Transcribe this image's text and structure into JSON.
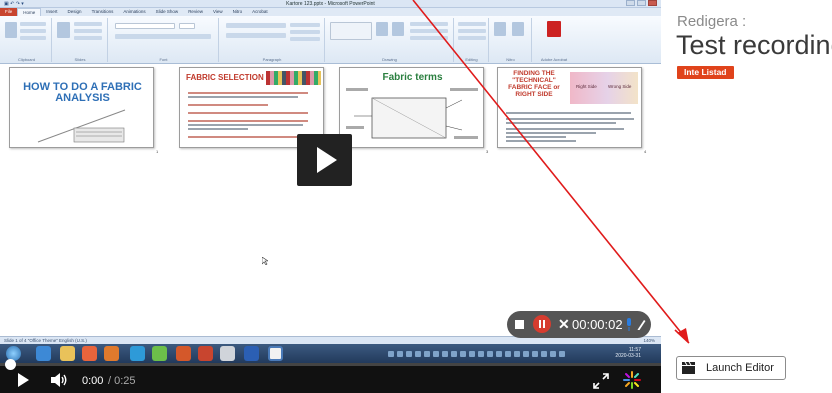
{
  "panel": {
    "label": "Redigera :",
    "title": "Test recording",
    "badge": "Inte Listad",
    "launch_button": "Launch Editor"
  },
  "player": {
    "current_time": "0:00",
    "duration": "/ 0:25",
    "progress_fraction": 0.0,
    "recorder_time": "00:00:02"
  },
  "powerpoint": {
    "window_title": "Kartore 123.pptx - Microsoft PowerPoint",
    "tabs": [
      "File",
      "Home",
      "Insert",
      "Design",
      "Transitions",
      "Animations",
      "Slide Show",
      "Review",
      "View",
      "Nitro",
      "Acrobat"
    ],
    "active_tab": "Home",
    "groups": [
      "Clipboard",
      "Slides",
      "Font",
      "Paragraph",
      "Drawing",
      "Editing",
      "Nitro",
      "Adobe Acrobat"
    ],
    "status_left": "Slide 1 of 4   \"Office Theme\"   English (U.S.)",
    "status_right": "140%",
    "slides": [
      {
        "number": "1",
        "title": "HOW TO DO A FABRIC ANALYSIS"
      },
      {
        "number": "2",
        "title": "FABRIC SELECTION"
      },
      {
        "number": "3",
        "title": "Fabric terms"
      },
      {
        "number": "4",
        "title": "FINDING THE \"TECHNICAL\" FABRIC FACE or RIGHT SIDE",
        "labels": [
          "Right Side",
          "Wrong Side"
        ]
      }
    ],
    "clock": {
      "time": "11:57",
      "date": "2020-03-31"
    }
  },
  "colors": {
    "accent_badge": "#e0431b",
    "progress": "#0a84d0",
    "record": "#d63c2f"
  }
}
